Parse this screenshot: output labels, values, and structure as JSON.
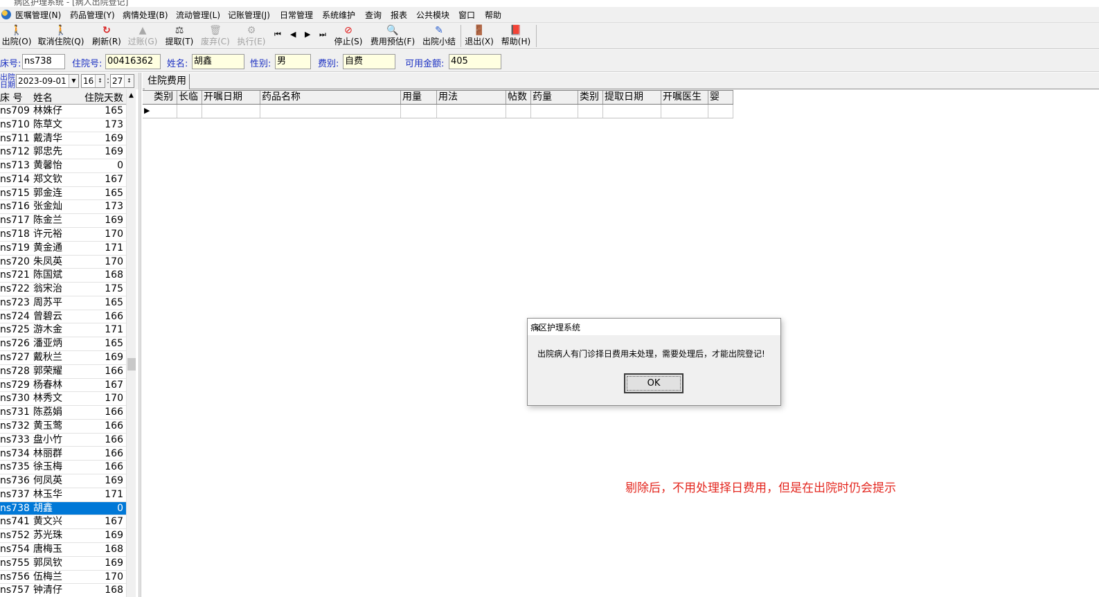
{
  "window": {
    "title": "病区护理系统 - [病人出院登记]"
  },
  "menu": [
    "医嘱管理(N)",
    "药品管理(Y)",
    "病情处理(B)",
    "流动管理(L)",
    "记账管理(J)",
    "日常管理",
    "系统维护",
    "查询",
    "报表",
    "公共模块",
    "窗口",
    "帮助"
  ],
  "toolbar": {
    "discharge": "出院(O)",
    "cancel_discharge": "取消住院(Q)",
    "refresh": "刷新(R)",
    "post": "过账(G)",
    "extract": "提取(T)",
    "discard": "废弃(C)",
    "execute": "执行(E)",
    "stop": "停止(S)",
    "fee_estimate": "费用预估(F)",
    "discharge_summary": "出院小结",
    "exit": "退出(X)",
    "help": "帮助(H)"
  },
  "patient": {
    "bed_label": "床号:",
    "bed": "ns738",
    "admission_label": "住院号:",
    "admission_no": "00416362",
    "name_label": "姓名:",
    "name": "胡鑫",
    "sex_label": "性别:",
    "sex": "男",
    "fee_type_label": "费别:",
    "fee_type": "自费",
    "balance_label": "可用金额:",
    "balance": "405"
  },
  "discharge_date": {
    "label": "出院日期",
    "date": "2023-09-01",
    "hour": "16",
    "minute": "27"
  },
  "patient_list": {
    "columns": [
      "床 号",
      "姓名",
      "住院天数"
    ],
    "rows": [
      {
        "bed": "ns709",
        "name": "林姝仔",
        "days": "165"
      },
      {
        "bed": "ns710",
        "name": "陈草文",
        "days": "173"
      },
      {
        "bed": "ns711",
        "name": "戴清华",
        "days": "169"
      },
      {
        "bed": "ns712",
        "name": "郭忠先",
        "days": "169"
      },
      {
        "bed": "ns713",
        "name": "黄馨怡",
        "days": "0"
      },
      {
        "bed": "ns714",
        "name": "郑文钦",
        "days": "167"
      },
      {
        "bed": "ns715",
        "name": "郭金连",
        "days": "165"
      },
      {
        "bed": "ns716",
        "name": "张金灿",
        "days": "173"
      },
      {
        "bed": "ns717",
        "name": "陈金兰",
        "days": "169"
      },
      {
        "bed": "ns718",
        "name": "许元裕",
        "days": "170"
      },
      {
        "bed": "ns719",
        "name": "黄金通",
        "days": "171"
      },
      {
        "bed": "ns720",
        "name": "朱凤英",
        "days": "170"
      },
      {
        "bed": "ns721",
        "name": "陈国斌",
        "days": "168"
      },
      {
        "bed": "ns722",
        "name": "翁宋治",
        "days": "175"
      },
      {
        "bed": "ns723",
        "name": "周苏平",
        "days": "165"
      },
      {
        "bed": "ns724",
        "name": "曾碧云",
        "days": "166"
      },
      {
        "bed": "ns725",
        "name": "游木金",
        "days": "171"
      },
      {
        "bed": "ns726",
        "name": "潘亚炳",
        "days": "165"
      },
      {
        "bed": "ns727",
        "name": "戴秋兰",
        "days": "169"
      },
      {
        "bed": "ns728",
        "name": "郭荣耀",
        "days": "166"
      },
      {
        "bed": "ns729",
        "name": "杨春林",
        "days": "167"
      },
      {
        "bed": "ns730",
        "name": "林秀文",
        "days": "170"
      },
      {
        "bed": "ns731",
        "name": "陈荔娟",
        "days": "166"
      },
      {
        "bed": "ns732",
        "name": "黄玉莺",
        "days": "166"
      },
      {
        "bed": "ns733",
        "name": "盘小竹",
        "days": "166"
      },
      {
        "bed": "ns734",
        "name": "林丽群",
        "days": "166"
      },
      {
        "bed": "ns735",
        "name": "徐玉梅",
        "days": "166"
      },
      {
        "bed": "ns736",
        "name": "何凤英",
        "days": "169"
      },
      {
        "bed": "ns737",
        "name": "林玉华",
        "days": "171"
      },
      {
        "bed": "ns738",
        "name": "胡鑫",
        "days": "0"
      },
      {
        "bed": "ns741",
        "name": "黄文兴",
        "days": "167"
      },
      {
        "bed": "ns752",
        "name": "苏光珠",
        "days": "169"
      },
      {
        "bed": "ns754",
        "name": "唐梅玉",
        "days": "168"
      },
      {
        "bed": "ns755",
        "name": "郭凤钦",
        "days": "169"
      },
      {
        "bed": "ns756",
        "name": "伍梅兰",
        "days": "170"
      },
      {
        "bed": "ns757",
        "name": "钟清仔",
        "days": "168"
      }
    ],
    "selected_index": 29
  },
  "tabs": [
    "住院费用"
  ],
  "fee_grid": {
    "columns": [
      "类别",
      "长临",
      "开嘱日期",
      "药品名称",
      "用量",
      "用法",
      "帖数",
      "药量",
      "类别",
      "提取日期",
      "开嘱医生",
      "婴"
    ]
  },
  "dialog": {
    "title": "病区护理系统",
    "message": "出院病人有门诊择日费用未处理，需要处理后，才能出院登记!",
    "ok_label": "OK"
  },
  "annotation": "剔除后，不用处理择日费用，但是在出院时仍会提示",
  "colors": {
    "label_blue": "#1a2fc2",
    "field_bg": "#ffffe1",
    "selection": "#0078d7",
    "annotation_red": "#e3261e"
  }
}
